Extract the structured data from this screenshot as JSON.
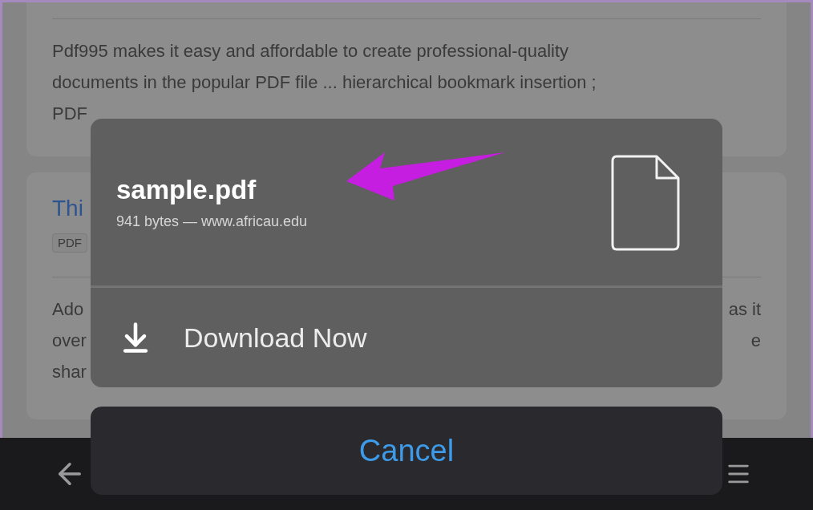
{
  "results": [
    {
      "snippet_lines": [
        {
          "left": "Pdf995 makes it easy and affordable to create professional-quality"
        },
        {
          "left": "documents in the popular PDF file ... hierarchical bookmark insertion ;"
        },
        {
          "left": "PDF"
        }
      ]
    },
    {
      "title": "Thi",
      "tag": "PDF",
      "snippet_lines": [
        {
          "left": "Ado",
          "right": "as it"
        },
        {
          "left": "over",
          "right": "e"
        },
        {
          "left": "shar"
        }
      ]
    }
  ],
  "download_sheet": {
    "file_name": "sample.pdf",
    "file_info": "941 bytes — www.africau.edu",
    "action": "Download Now",
    "cancel": "Cancel"
  }
}
